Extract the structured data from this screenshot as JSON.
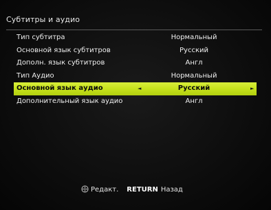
{
  "menu": {
    "title": "Субтитры и аудио"
  },
  "rows": [
    {
      "label": "Тип субтитра",
      "value": "Нормальный",
      "selected": false
    },
    {
      "label": "Основной язык субтитров",
      "value": "Русский",
      "selected": false
    },
    {
      "label": "Дополн. язык субтитров",
      "value": "Англ",
      "selected": false
    },
    {
      "label": "Тип Аудио",
      "value": "Нормальный",
      "selected": false
    },
    {
      "label": "Основной язык аудио",
      "value": "Русский",
      "selected": true
    },
    {
      "label": "Дополнительный язык аудио",
      "value": "Англ",
      "selected": false
    }
  ],
  "selected_row": {
    "left_arrow": "◄",
    "right_arrow": "►"
  },
  "footer": {
    "dpad_icon": "dpad-icon",
    "edit_label": "Редакт.",
    "return_key": "RETURN",
    "back_label": "Назад"
  },
  "colors": {
    "highlight": "#c6e21c",
    "background": "#0e0e0e",
    "text": "#f0f0f0"
  }
}
